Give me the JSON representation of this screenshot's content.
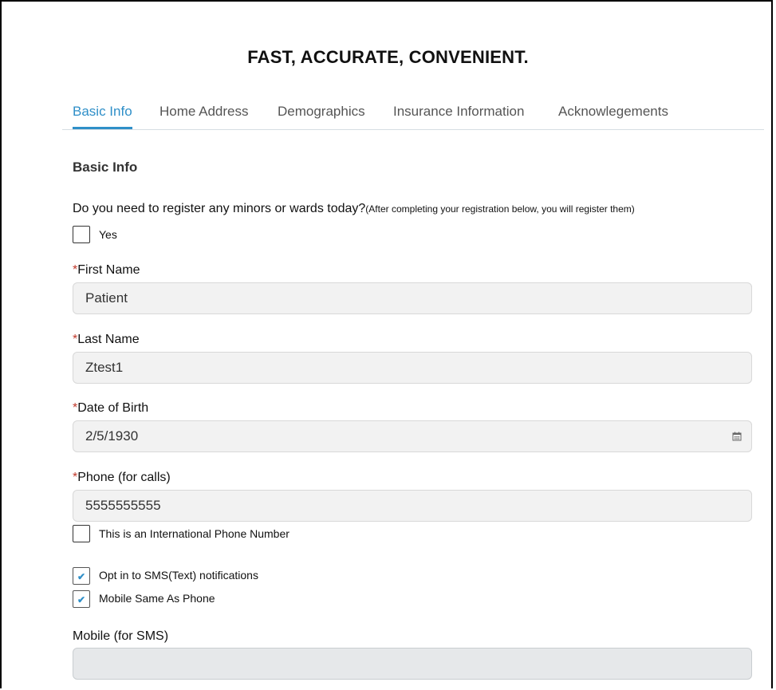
{
  "header": {
    "title": "FAST, ACCURATE, CONVENIENT."
  },
  "tabs": [
    {
      "label": "Basic Info",
      "active": true
    },
    {
      "label": "Home Address",
      "active": false
    },
    {
      "label": "Demographics",
      "active": false
    },
    {
      "label": "Insurance Information",
      "active": false
    },
    {
      "label": "Acknowlegements",
      "active": false
    }
  ],
  "section": {
    "title": "Basic Info"
  },
  "minors": {
    "question": "Do you need to register any minors or wards today?",
    "note": "(After completing your registration below, you will register them)",
    "yes_label": "Yes",
    "yes_checked": false
  },
  "required_marker": "*",
  "fields": {
    "first_name": {
      "label": "First Name",
      "value": "Patient"
    },
    "last_name": {
      "label": "Last Name",
      "value": "Ztest1"
    },
    "dob": {
      "label": "Date of Birth",
      "value": "2/5/1930"
    },
    "phone": {
      "label": "Phone (for calls)",
      "value": "5555555555"
    },
    "mobile": {
      "label": "Mobile (for SMS)",
      "value": ""
    }
  },
  "checkboxes": {
    "international": {
      "label": "This is an International Phone Number",
      "checked": false
    },
    "sms_opt_in": {
      "label": "Opt in to SMS(Text) notifications",
      "checked": true
    },
    "mobile_same": {
      "label": "Mobile Same As Phone",
      "checked": true
    }
  },
  "icons": {
    "date": "calendar-icon",
    "check": "checkmark-icon"
  },
  "colors": {
    "accent": "#2f8fc8",
    "required": "#c0392b",
    "input_bg": "#f2f2f2"
  }
}
